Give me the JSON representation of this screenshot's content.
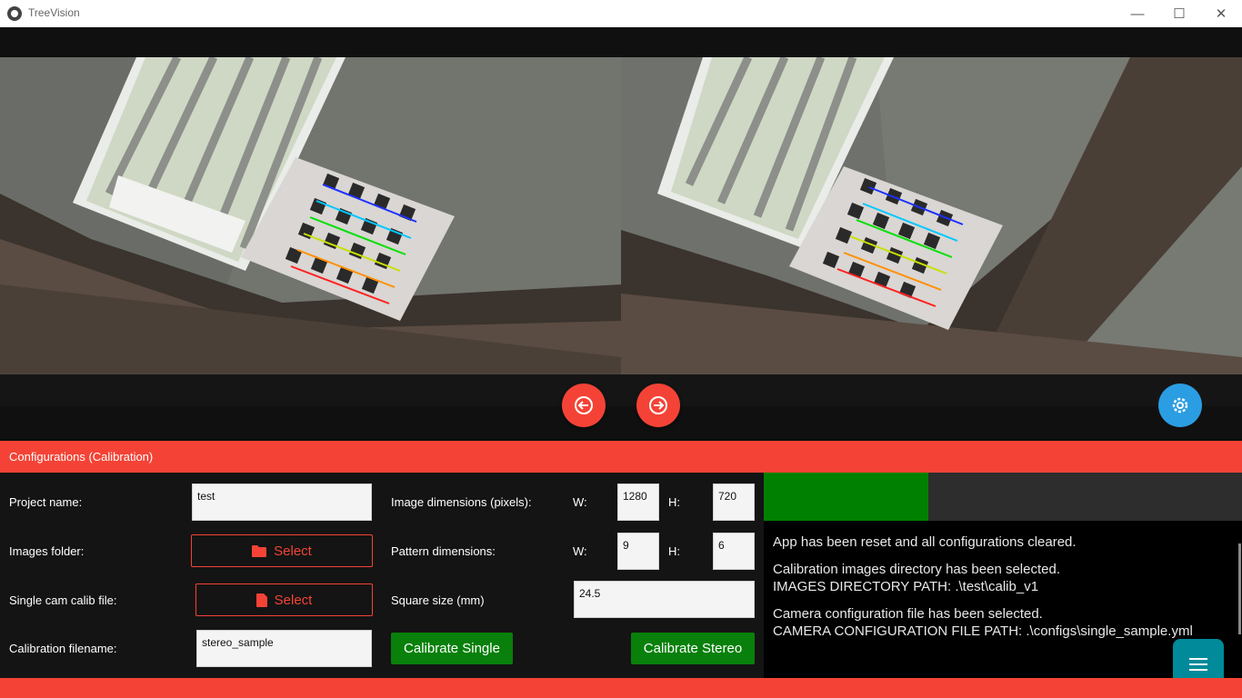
{
  "window": {
    "title": "TreeVision",
    "minimize_glyph": "—",
    "maximize_glyph": "☐",
    "close_glyph": "✕"
  },
  "camera": {
    "left_view": "left-camera-preview",
    "right_view": "right-camera-preview"
  },
  "nav": {
    "prev_icon": "arrow-left-circle-icon",
    "next_icon": "arrow-right-circle-icon",
    "settings_icon": "cog-sync-icon"
  },
  "config": {
    "header": "Configurations (Calibration)",
    "project_name_label": "Project name:",
    "project_name_value": "test",
    "images_folder_label": "Images folder:",
    "images_folder_button": "Select",
    "single_cam_label": "Single cam calib file:",
    "single_cam_button": "Select",
    "calib_filename_label": "Calibration filename:",
    "calib_filename_value": "stereo_sample",
    "image_dims_label": "Image dimensions (pixels):",
    "image_w_label": "W:",
    "image_w_value": "1280",
    "image_h_label": "H:",
    "image_h_value": "720",
    "pattern_dims_label": "Pattern dimensions:",
    "pattern_w_label": "W:",
    "pattern_w_value": "9",
    "pattern_h_label": "H:",
    "pattern_h_value": "6",
    "square_size_label": "Square size (mm)",
    "square_size_value": "24.5",
    "calibrate_single_button": "Calibrate Single",
    "calibrate_stereo_button": "Calibrate Stereo"
  },
  "progress": {
    "fraction": 0.345
  },
  "log": {
    "entries": [
      "App has been reset and all configurations cleared.",
      "Calibration images directory has been selected.\nIMAGES DIRECTORY PATH: .\\test\\calib_v1",
      "Camera configuration file has been selected.\nCAMERA CONFIGURATION FILE PATH: .\\configs\\single_sample.yml"
    ]
  },
  "colors": {
    "accent_red": "#f44336",
    "accent_green": "#08800b",
    "settings_blue": "#2b9de2",
    "fab_teal": "#008a9a"
  },
  "fab": {
    "icon": "menu-icon"
  }
}
